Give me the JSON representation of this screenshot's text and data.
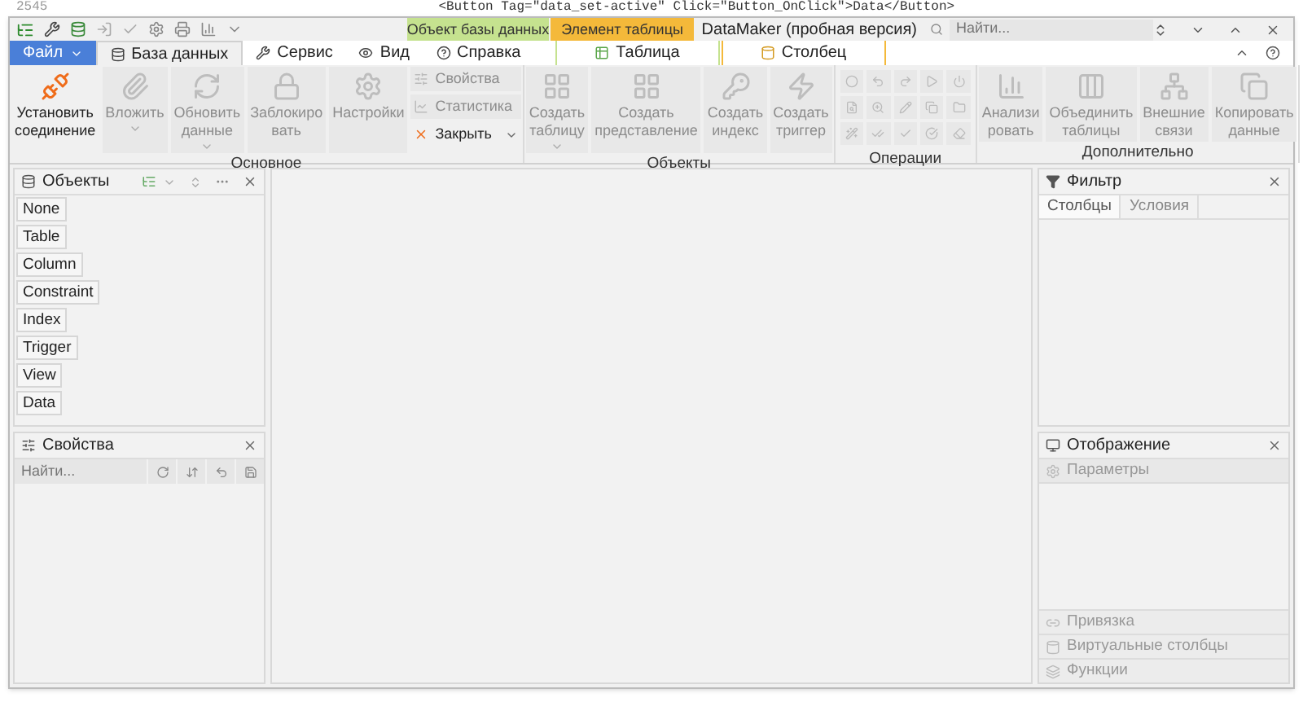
{
  "background": {
    "line_number": "2545",
    "code": "<Button Tag=\"data_set-active\" Click=\"Button_OnClick\">Data</Button>"
  },
  "window": {
    "title": "DataMaker (пробная версия)",
    "search_placeholder": "Найти..."
  },
  "context_groups": [
    {
      "label": "Объект базы данных",
      "color": "#c5e28f",
      "tab": "Таблица"
    },
    {
      "label": "Элемент таблицы",
      "color": "#f4b93a",
      "tab": "Столбец"
    }
  ],
  "file_menu": "Файл",
  "tabs": [
    {
      "label": "База данных",
      "selected": true
    },
    {
      "label": "Сервис",
      "selected": false
    },
    {
      "label": "Вид",
      "selected": false
    },
    {
      "label": "Справка",
      "selected": false
    }
  ],
  "ribbon_groups": [
    {
      "label": "Основное",
      "items": [
        {
          "kind": "large",
          "lines": [
            "Установить",
            "соединение"
          ],
          "disabled": false,
          "dropdown": false
        },
        {
          "kind": "large",
          "lines": [
            "Вложить"
          ],
          "disabled": true,
          "dropdown": true
        },
        {
          "kind": "large",
          "lines": [
            "Обновить",
            "данные"
          ],
          "disabled": true,
          "dropdown": true
        },
        {
          "kind": "large",
          "lines": [
            "Заблокиро",
            "вать"
          ],
          "disabled": true,
          "dropdown": false
        },
        {
          "kind": "large",
          "lines": [
            "Настройки"
          ],
          "disabled": true,
          "dropdown": false
        },
        {
          "kind": "stack",
          "entries": [
            {
              "label": "Свойства",
              "disabled": true,
              "dropdown": false
            },
            {
              "label": "Статистика",
              "disabled": true,
              "dropdown": false
            },
            {
              "label": "Закрыть",
              "disabled": false,
              "dropdown": true
            }
          ]
        }
      ]
    },
    {
      "label": "Объекты",
      "items": [
        {
          "kind": "large",
          "lines": [
            "Создать",
            "таблицу"
          ],
          "disabled": true,
          "dropdown": true
        },
        {
          "kind": "large",
          "lines": [
            "Создать",
            "представление"
          ],
          "disabled": true,
          "dropdown": false
        },
        {
          "kind": "large",
          "lines": [
            "Создать",
            "индекс"
          ],
          "disabled": true,
          "dropdown": false
        },
        {
          "kind": "large",
          "lines": [
            "Создать",
            "триггер"
          ],
          "disabled": true,
          "dropdown": false
        }
      ]
    },
    {
      "label": "Операции",
      "items": [
        {
          "kind": "icon_grid"
        }
      ]
    },
    {
      "label": "Дополнительно",
      "items": [
        {
          "kind": "large",
          "lines": [
            "Анализи",
            "ровать"
          ],
          "disabled": true,
          "dropdown": false
        },
        {
          "kind": "large",
          "lines": [
            "Объединить",
            "таблицы"
          ],
          "disabled": true,
          "dropdown": false
        },
        {
          "kind": "large",
          "lines": [
            "Внешние",
            "связи"
          ],
          "disabled": true,
          "dropdown": false
        },
        {
          "kind": "large",
          "lines": [
            "Копировать",
            "данные"
          ],
          "disabled": true,
          "dropdown": false
        }
      ]
    }
  ],
  "objects_panel": {
    "title": "Объекты",
    "items": [
      "None",
      "Table",
      "Column",
      "Constraint",
      "Index",
      "Trigger",
      "View",
      "Data"
    ]
  },
  "properties_panel": {
    "title": "Свойства",
    "search_placeholder": "Найти..."
  },
  "filter_panel": {
    "title": "Фильтр",
    "tabs": [
      {
        "label": "Столбцы",
        "selected": true
      },
      {
        "label": "Условия",
        "selected": false
      }
    ]
  },
  "display_panel": {
    "title": "Отображение",
    "sections": [
      "Параметры"
    ],
    "bottom_sections": [
      "Привязка",
      "Виртуальные столбцы",
      "Функции"
    ]
  }
}
